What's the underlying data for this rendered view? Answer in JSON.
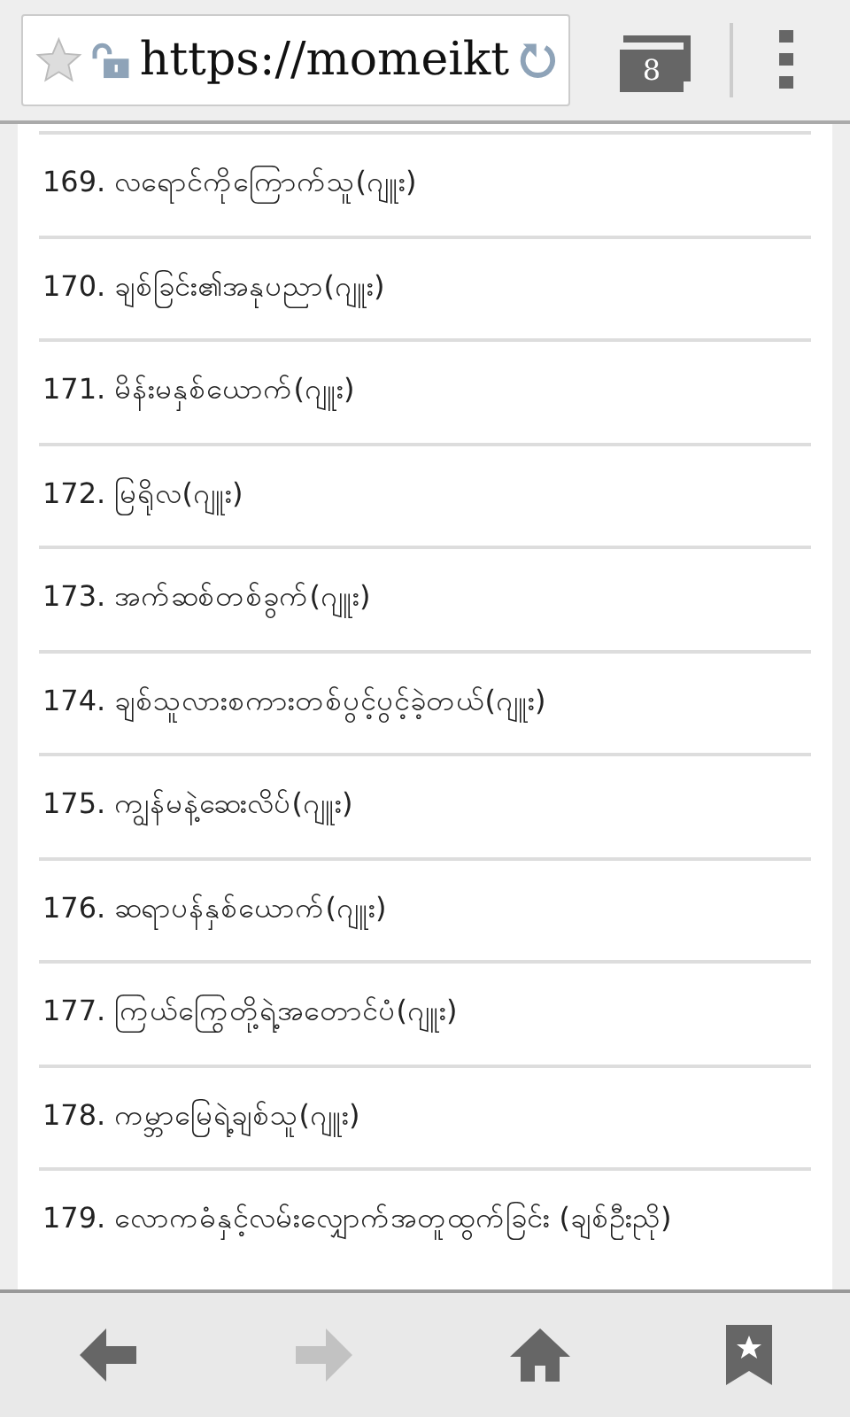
{
  "address_bar": {
    "url": "https://momeikt",
    "tab_count": "8"
  },
  "items": [
    {
      "label": "169. လရောင်ကိုကြောက်သူ(ဂျူး)"
    },
    {
      "label": "170. ချစ်ခြင်း၏အနုပညာ(ဂျူး)"
    },
    {
      "label": "171. မိန်းမနှစ်ယောက်(ဂျူး)"
    },
    {
      "label": "172. မြရိုလ(ဂျူး)"
    },
    {
      "label": "173. အက်ဆစ်တစ်ခွက်(ဂျူး)"
    },
    {
      "label": "174. ချစ်သူလားစကားတစ်ပွင့်ပွင့်ခဲ့တယ်(ဂျူး)"
    },
    {
      "label": "175. ကျွန်မနဲ့ဆေးလိပ်(ဂျူး)"
    },
    {
      "label": "176. ဆရာပန်နှစ်ယောက်(ဂျူး)"
    },
    {
      "label": "177. ကြယ်ကြွေတို့ရဲ့အတောင်ပံ(ဂျူး)"
    },
    {
      "label": "178. ကမ္ဘာမြေရဲ့ချစ်သူ(ဂျူး)"
    },
    {
      "label": "179. လောကဓံနှင့်လမ်းလျှောက်အတူထွက်ခြင်း (ချစ်ဦးညို)"
    }
  ],
  "nav_buttons": [
    {
      "kind": "back",
      "disabled": false
    },
    {
      "kind": "forward",
      "disabled": true
    },
    {
      "kind": "home",
      "disabled": false
    },
    {
      "kind": "bookmarks",
      "disabled": false
    }
  ]
}
